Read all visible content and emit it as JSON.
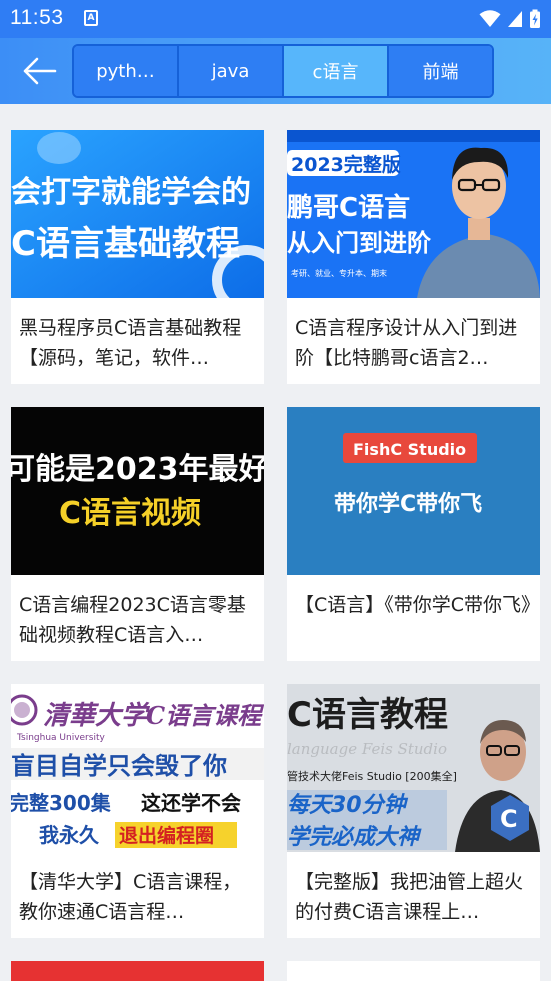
{
  "status_bar": {
    "time": "11:53",
    "notification_icon": "A"
  },
  "app_bar": {
    "back_icon": "arrow-left-icon",
    "tabs": [
      {
        "label": "pyth…",
        "active": false
      },
      {
        "label": "java",
        "active": false
      },
      {
        "label": "c语言",
        "active": true
      },
      {
        "label": "前端",
        "active": false
      }
    ]
  },
  "colors": {
    "status_bar": "#2f7df4",
    "tab_active": "#57b6fb",
    "tab_inactive": "#2e7ef3",
    "card_bg": "#ffffff"
  },
  "videos": [
    {
      "title": "黑马程序员C语言基础教程【源码，笔记，软件…",
      "thumb_text": [
        "会打字就能学会的",
        "C语言基础教程"
      ]
    },
    {
      "title": "C语言程序设计从入门到进阶【比特鹏哥c语言2…",
      "thumb_text": [
        "2023完整版",
        "鹏哥C语言",
        "从入门到进阶",
        "考研、就业、专升本、期末"
      ]
    },
    {
      "title": "C语言编程2023C语言零基础视频教程C语言入…",
      "thumb_text": [
        "可能是2023年最好",
        "C语言视频"
      ]
    },
    {
      "title": "【C语言】《带你学C带你飞》",
      "thumb_text": [
        "FishC Studio",
        "带你学C带你飞"
      ]
    },
    {
      "title": "【清华大学】C语言课程，教你速通C语言程…",
      "thumb_text": [
        "清華大学",
        "C语言课程",
        "Tsinghua University",
        "盲目自学只会毁了你",
        "完整300集",
        "这还学不会",
        "我永久",
        "退出编程圈"
      ]
    },
    {
      "title": "【完整版】我把油管上超火的付费C语言课程上…",
      "thumb_text": [
        "C语言教程",
        "language Feis Studio",
        "管技术大佬Feis Studio [200集全]",
        "每天30分钟",
        "学完必成大神",
        "C"
      ]
    }
  ]
}
